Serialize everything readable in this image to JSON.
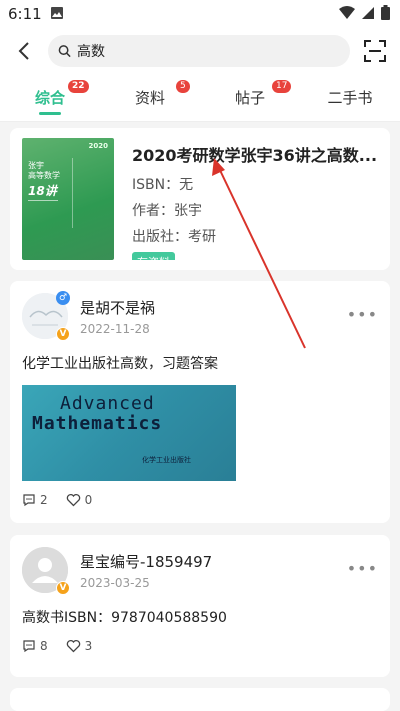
{
  "status": {
    "time": "6:11"
  },
  "search": {
    "value": "高数"
  },
  "tabs": [
    {
      "label": "综合",
      "badge": "22"
    },
    {
      "label": "资料",
      "badge": "5"
    },
    {
      "label": "帖子",
      "badge": "17"
    },
    {
      "label": "二手书",
      "badge": ""
    }
  ],
  "book": {
    "title": "2020考研数学张宇36讲之高数...",
    "isbn": "ISBN：无",
    "author": "作者：张宇",
    "publisher": "出版社：考研",
    "tag": "有资料",
    "cover": {
      "year": "2020",
      "line1": "张宇",
      "line2": "高等数学",
      "line3": "18讲"
    }
  },
  "posts": [
    {
      "name": "是胡不是祸",
      "date": "2022-11-28",
      "text": "化学工业出版社高数，习题答案",
      "image": {
        "line1": "Advanced",
        "line2": "Mathematics",
        "line3": "化学工业出版社"
      },
      "comments": "2",
      "likes": "0"
    },
    {
      "name": "星宝编号-1859497",
      "date": "2023-03-25",
      "text": "高数书ISBN：9787040588590",
      "comments": "8",
      "likes": "3"
    }
  ],
  "colors": {
    "accent": "#2fbf8f",
    "badge": "#e8433c",
    "arrow": "#d9342b"
  }
}
